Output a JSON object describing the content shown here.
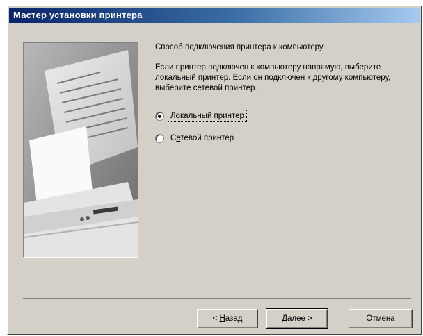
{
  "window": {
    "title": "Мастер установки принтера"
  },
  "content": {
    "heading": "Способ подключения принтера к компьютеру.",
    "description": "Если принтер подключен к компьютеру напрямую, выберите локальный принтер. Если он подключен к другому компьютеру, выберите сетевой принтер."
  },
  "options": [
    {
      "label_mnemonic": "Л",
      "label_rest": "окальный принтер",
      "checked": true
    },
    {
      "label_pre": "С",
      "label_mnemonic": "е",
      "label_rest": "тевой принтер",
      "checked": false
    }
  ],
  "buttons": {
    "back_prefix": "< ",
    "back_mnemonic": "Н",
    "back_rest": "азад",
    "next_mnemonic": "Д",
    "next_rest": "алее >",
    "cancel": "Отмена"
  }
}
